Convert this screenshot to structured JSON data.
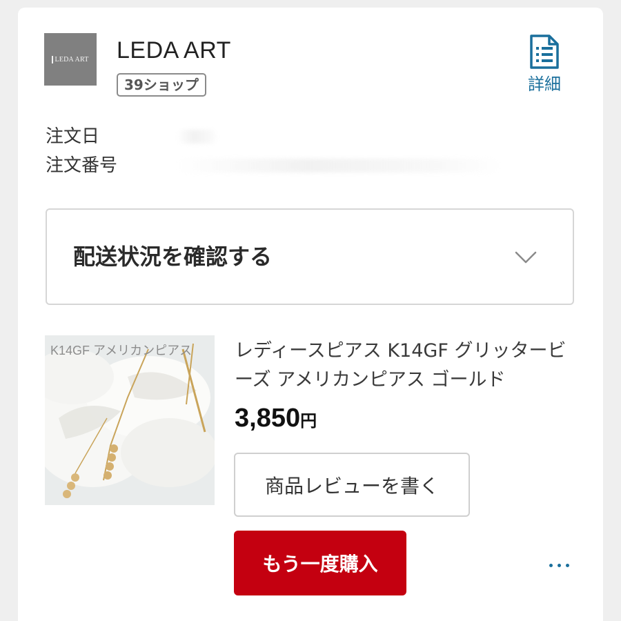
{
  "shop": {
    "logo_text": "LEDA ART",
    "name": "LEDA ART",
    "badge": "39ショップ",
    "detail_label": "詳細"
  },
  "order": {
    "date_label": "注文日",
    "number_label": "注文番号"
  },
  "delivery": {
    "label": "配送状況を確認する"
  },
  "product": {
    "image_text": "K14GF アメリカンピアス",
    "title": "レディースピアス K14GF グリッタービーズ アメリカンピアス ゴールド",
    "price_amount": "3,850",
    "price_unit": "円",
    "review_label": "商品レビューを書く",
    "rebuy_label": "もう一度購入"
  },
  "colors": {
    "accent_blue": "#1a6f9c",
    "rebuy_red": "#c40010",
    "border_gray": "#d6d6d6"
  },
  "icons": [
    "document-list-icon",
    "chevron-down-icon",
    "more-horizontal-icon"
  ]
}
